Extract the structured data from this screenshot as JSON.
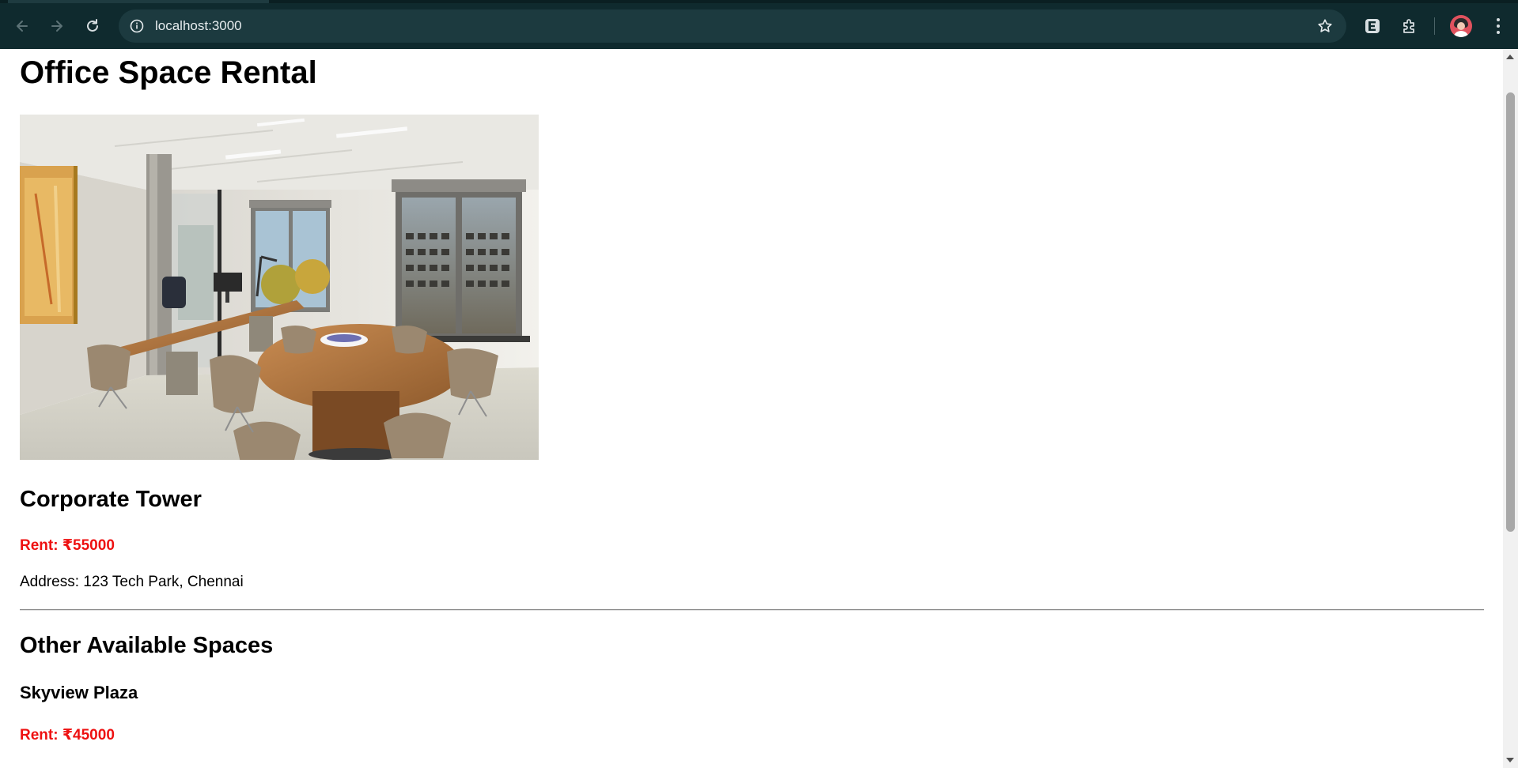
{
  "browser": {
    "url": "localhost:3000"
  },
  "page": {
    "title": "Office Space Rental",
    "hero_image": "office-interior-photo",
    "featured": {
      "name": "Corporate Tower",
      "rent": "Rent: ₹55000",
      "address": "Address: 123 Tech Park, Chennai"
    },
    "other_section_title": "Other Available Spaces",
    "listings": [
      {
        "name": "Skyview Plaza",
        "rent": "Rent: ₹45000"
      }
    ]
  },
  "colors": {
    "browser_chrome": "#0f2a2e",
    "omnibox": "#1c3a3f",
    "rent_text": "#ee1111"
  }
}
